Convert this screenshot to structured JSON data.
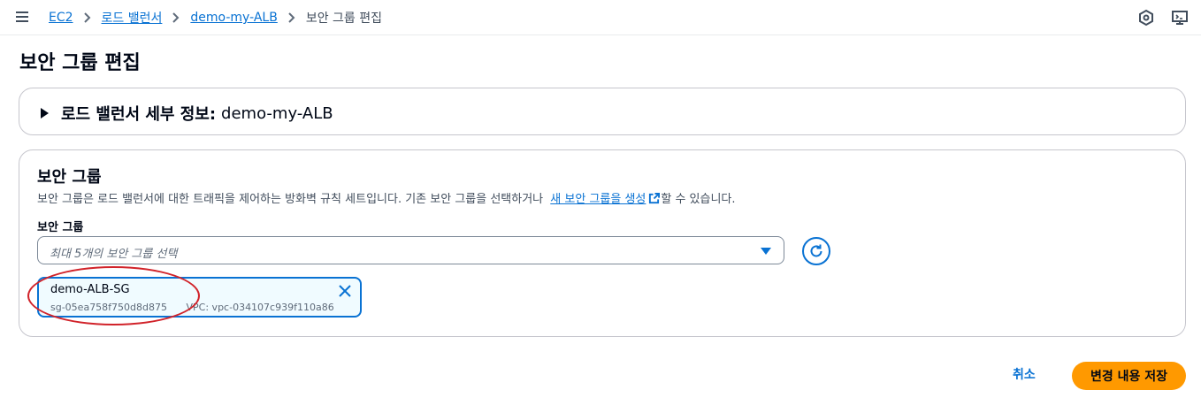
{
  "breadcrumb": {
    "items": [
      {
        "label": "EC2"
      },
      {
        "label": "로드 밸런서"
      },
      {
        "label": "demo-my-ALB"
      }
    ],
    "current": "보안 그룹 편집"
  },
  "page": {
    "title": "보안 그룹 편집"
  },
  "details_panel": {
    "label_prefix": "로드 밸런서 세부 정보:",
    "label_value": "demo-my-ALB"
  },
  "security_group_panel": {
    "title": "보안 그룹",
    "description_before": "보안 그룹은 로드 밸런서에 대한 트래픽을 제어하는 방화벽 규칙 세트입니다. 기존 보안 그룹을 선택하거나",
    "description_link": "새 보안 그룹을 생성",
    "description_after": "할 수 있습니다.",
    "field_label": "보안 그룹",
    "select_placeholder": "최대 5개의 보안 그룹 선택",
    "selected": {
      "name": "demo-ALB-SG",
      "id": "sg-05ea758f750d8d875",
      "vpc": "VPC: vpc-034107c939f110a86"
    }
  },
  "footer": {
    "cancel_label": "취소",
    "save_label": "변경 내용 저장"
  },
  "icons": {
    "menu": "hamburger-menu-icon",
    "settings": "hexagon-settings-icon",
    "console": "monitor-console-icon",
    "external": "external-link-icon",
    "refresh": "refresh-icon",
    "close": "close-icon"
  },
  "colors": {
    "link": "#0972d3",
    "primary_button": "#ff9900",
    "annotation": "#d1232a"
  }
}
